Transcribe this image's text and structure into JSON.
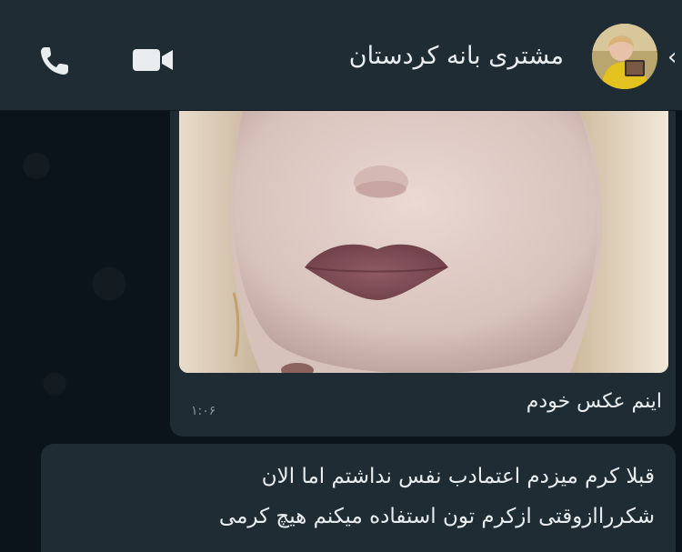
{
  "header": {
    "contact_name": "مشتری بانه کردستان",
    "back_symbol": "‹"
  },
  "messages": [
    {
      "type": "image",
      "caption": "اینم عکس خودم",
      "time": "۱:۰۶"
    },
    {
      "type": "text",
      "lines": [
        "قبلا کرم میزدم اعتمادب نفس نداشتم اما الان",
        "شکرراازوقتی ازکرم تون استفاده میکنم هیچ کرمی"
      ]
    }
  ],
  "colors": {
    "header_bg": "#1f2c34",
    "chat_bg": "#0b141a",
    "bubble_bg": "#1f2c34",
    "text": "#e9edef",
    "meta_text": "#8696a0"
  },
  "icons": [
    "phone-icon",
    "video-camera-icon",
    "back-arrow-icon"
  ]
}
